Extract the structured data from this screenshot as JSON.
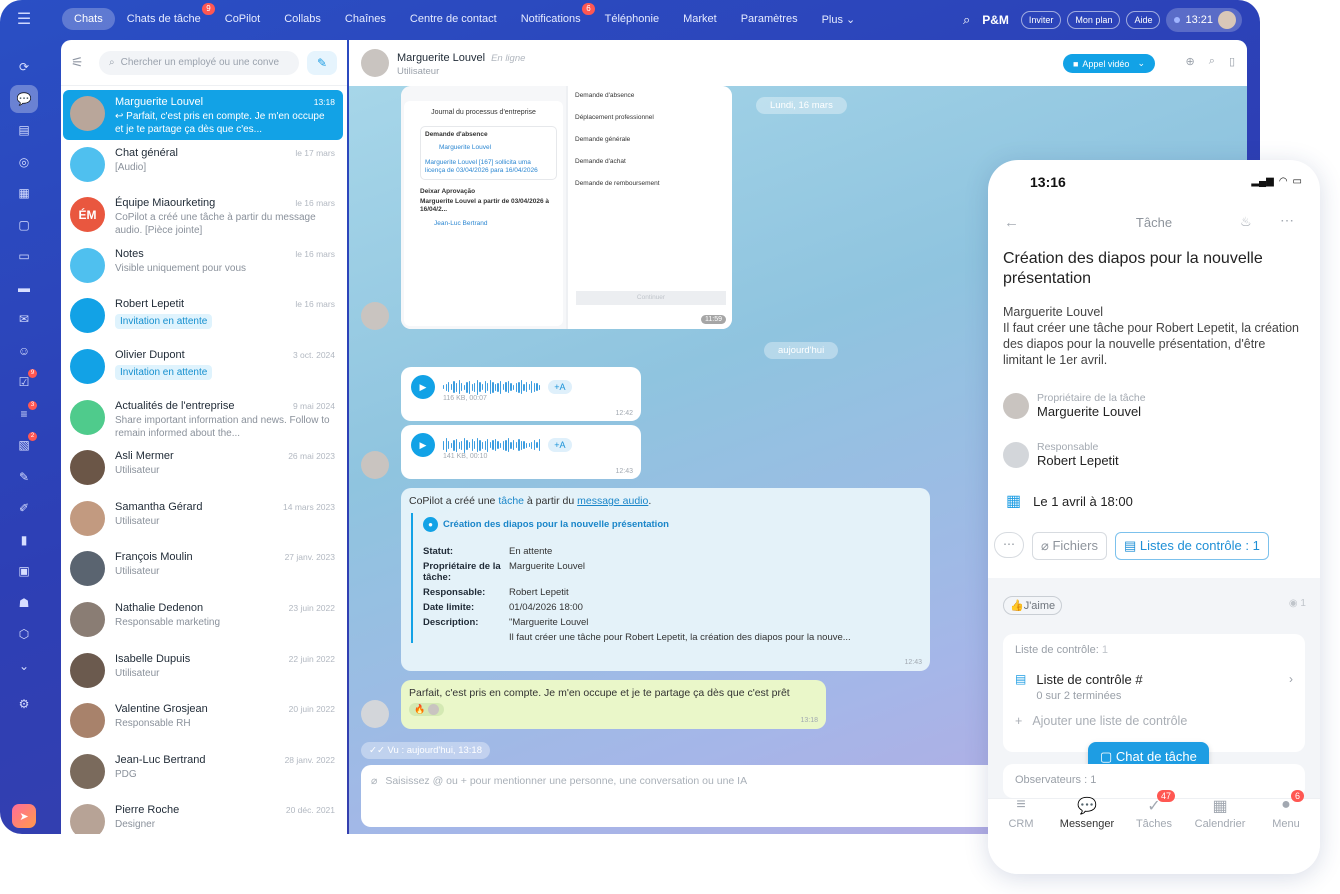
{
  "topbar": {
    "tabs": [
      {
        "label": "Chats",
        "active": true,
        "badge": ""
      },
      {
        "label": "Chats de tâche",
        "badge": "9"
      },
      {
        "label": "CoPilot",
        "badge": ""
      },
      {
        "label": "Collabs",
        "badge": ""
      },
      {
        "label": "Chaînes",
        "badge": ""
      },
      {
        "label": "Centre de contact",
        "badge": ""
      },
      {
        "label": "Notifications",
        "badge": "6"
      },
      {
        "label": "Téléphonie",
        "badge": ""
      },
      {
        "label": "Market",
        "badge": ""
      },
      {
        "label": "Paramètres",
        "badge": ""
      },
      {
        "label": "Plus ⌄",
        "badge": ""
      }
    ],
    "brand": "P&M",
    "invite": "Inviter",
    "plan": "Mon plan",
    "help": "Aide",
    "time": "13:21"
  },
  "sidebar": {
    "badges": [
      "9",
      "3",
      "2"
    ]
  },
  "chatlist": {
    "search_placeholder": "Chercher un employé ou une conve",
    "items": [
      {
        "name": "Marguerite Louvel",
        "time": "13:18",
        "preview": "↩ Parfait, c'est pris en compte. Je m'en occupe et je te partage ça dès que c'es...",
        "selected": true
      },
      {
        "name": "Chat général",
        "time": "le 17 mars",
        "preview": "[Audio]"
      },
      {
        "name": "Équipe Miaourketing",
        "time": "le 16 mars",
        "preview": "CoPilot a créé une tâche à partir du message audio. [Pièce jointe]",
        "initials": "ÉM"
      },
      {
        "name": "Notes",
        "time": "le 16 mars",
        "preview": "Visible uniquement pour vous"
      },
      {
        "name": "Robert Lepetit",
        "time": "le 16 mars",
        "preview": "Invitation en attente"
      },
      {
        "name": "Olivier Dupont",
        "time": "3 oct. 2024",
        "preview": "Invitation en attente"
      },
      {
        "name": "Actualités de l'entreprise",
        "time": "9 mai 2024",
        "preview": "Share important information and news. Follow to remain informed about the..."
      },
      {
        "name": "Asli Mermer",
        "time": "26 mai 2023",
        "preview": "Utilisateur"
      },
      {
        "name": "Samantha Gérard",
        "time": "14 mars 2023",
        "preview": "Utilisateur"
      },
      {
        "name": "François Moulin",
        "time": "27 janv. 2023",
        "preview": "Utilisateur"
      },
      {
        "name": "Nathalie Dedenon",
        "time": "23 juin 2022",
        "preview": "Responsable marketing"
      },
      {
        "name": "Isabelle Dupuis",
        "time": "22 juin 2022",
        "preview": "Utilisateur"
      },
      {
        "name": "Valentine Grosjean",
        "time": "20 juin 2022",
        "preview": "Responsable RH"
      },
      {
        "name": "Jean-Luc Bertrand",
        "time": "28 janv. 2022",
        "preview": "PDG"
      },
      {
        "name": "Pierre Roche",
        "time": "20 déc. 2021",
        "preview": "Designer"
      }
    ]
  },
  "conversation": {
    "name": "Marguerite Louvel",
    "status": "En ligne",
    "role": "Utilisateur",
    "video_label": "Appel vidéo",
    "date_1": "Lundi, 16 mars",
    "date_2": "aujourd'hui",
    "shot": {
      "title": "Journal du processus d'entreprise",
      "step1": "Demande d'absence",
      "step1_sub": "Marguerite Louvel",
      "step1_text": "Marguerite Louvel [167] sollicita uma licença de 03/04/2026 para 16/04/2026",
      "step2": "Deixar Aprovação",
      "step2_text": "Marguerite Louvel a partir de 03/04/2026 à 16/04/2...",
      "step2_sub": "Jean-Luc Bertrand",
      "menu": [
        "Demande d'absence",
        "Déplacement professionnel",
        "Demande générale",
        "Demande d'achat",
        "Demande de remboursement"
      ],
      "continue": "Continuer",
      "time": "11:59"
    },
    "audio": [
      {
        "meta": "116 KB, 00:07",
        "time": "12:42"
      },
      {
        "meta": "141 KB, 00:10",
        "time": "12:43"
      }
    ],
    "audio_btn": "+A",
    "copilot": {
      "intro_pre": "CoPilot a créé une ",
      "intro_link1": "tâche",
      "intro_mid": " à partir du ",
      "intro_link2": "message audio",
      "intro_end": ".",
      "task_title": "Création des diapos pour la nouvelle présentation",
      "fields": [
        {
          "label": "Statut:",
          "value": "En attente"
        },
        {
          "label": "Propriétaire de la tâche:",
          "value": "Marguerite Louvel"
        },
        {
          "label": "Responsable:",
          "value": "Robert Lepetit"
        },
        {
          "label": "Date limite:",
          "value": "01/04/2026 18:00"
        },
        {
          "label": "Description:",
          "value": "\"Marguerite Louvel"
        }
      ],
      "desc2": "Il faut créer une tâche pour Robert Lepetit, la création des diapos pour la nouve...",
      "time": "12:43"
    },
    "reply": {
      "text": "Parfait, c'est pris en compte. Je m'en occupe et je te partage ça dès que c'est prêt",
      "time": "13:18"
    },
    "seen": "✓✓ Vu : aujourd'hui, 13:18",
    "input_placeholder": "Saisissez @ ou + pour mentionner une personne, une conversation ou une IA"
  },
  "phone": {
    "time": "13:16",
    "header": "Tâche",
    "title": "Création des diapos pour la nouvelle présentation",
    "desc_author": "Marguerite Louvel",
    "desc": "Il faut créer une tâche pour Robert Lepetit, la création des diapos pour la nouvelle présentation, d'être limitant le 1er avril.",
    "owner_label": "Propriétaire de la tâche",
    "owner": "Marguerite Louvel",
    "resp_label": "Responsable",
    "resp": "Robert Lepetit",
    "deadline": "Le 1 avril à 18:00",
    "files": "Fichiers",
    "checklists": "Listes de contrôle : 1",
    "like": "J'aime",
    "checklist_label": "Liste de contrôle:",
    "checklist_count": "1",
    "checklist_name": "Liste de contrôle #",
    "checklist_progress": "0 sur 2 terminées",
    "add_checklist": "Ajouter une liste de contrôle",
    "chat_btn": "Chat de tâche",
    "observers": "Observateurs : 1",
    "nav": [
      {
        "label": "CRM",
        "badge": ""
      },
      {
        "label": "Messenger",
        "badge": ""
      },
      {
        "label": "Tâches",
        "badge": "47"
      },
      {
        "label": "Calendrier",
        "badge": ""
      },
      {
        "label": "Menu",
        "badge": "6"
      }
    ]
  },
  "colors": {
    "accent": "#12a2e6",
    "badge": "#ff5752",
    "app_bg": "#2d3fb5"
  }
}
